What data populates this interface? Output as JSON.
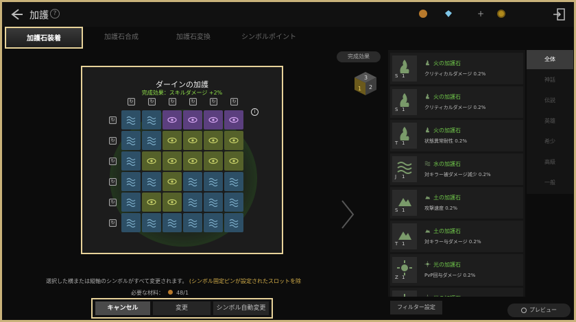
{
  "header": {
    "title": "加護",
    "help": "?"
  },
  "tabs": [
    {
      "label": "加護石装着",
      "active": true
    },
    {
      "label": "加護石合成",
      "active": false
    },
    {
      "label": "加護石変換",
      "active": false
    },
    {
      "label": "シンボルポイント",
      "active": false
    }
  ],
  "board": {
    "title": "ダーインの加護",
    "effect": "完成効果：スキルダメージ +2%",
    "info": "i"
  },
  "complete_button": "完成効果",
  "cube": {
    "faces": [
      "3",
      "1",
      "2"
    ]
  },
  "instructions": {
    "main": "選択した横または縦軸のシンボルがすべて変更されます。",
    "highlight": "(シンボル固定ピンが設定されたスロットを除"
  },
  "materials": {
    "label": "必要な材料：",
    "value": "48/1"
  },
  "buttons": {
    "cancel": "キャンセル",
    "change": "変更",
    "auto": "シンボル自動変更"
  },
  "right_tabs": [
    "全体",
    "神話",
    "伝説",
    "英雄",
    "希少",
    "高級",
    "一般"
  ],
  "items": [
    {
      "name": "火の加護石",
      "stat": "クリティカルダメージ 0.2%",
      "letter": "S",
      "count": "1",
      "color": "#6fc54a",
      "icon": "fire-icon"
    },
    {
      "name": "火の加護石",
      "stat": "クリティカルダメージ 0.2%",
      "letter": "S",
      "count": "1",
      "color": "#6fc54a",
      "icon": "fire-icon"
    },
    {
      "name": "火の加護石",
      "stat": "状態異常耐性 0.2%",
      "letter": "T",
      "count": "1",
      "color": "#6fc54a",
      "icon": "fire-icon"
    },
    {
      "name": "水の加護石",
      "stat": "対キラー被ダメージ減少 0.2%",
      "letter": "J",
      "count": "1",
      "color": "#6fc54a",
      "icon": "water-icon"
    },
    {
      "name": "土の加護石",
      "stat": "攻撃速度 0.2%",
      "letter": "S",
      "count": "1",
      "color": "#6fc54a",
      "icon": "earth-icon"
    },
    {
      "name": "土の加護石",
      "stat": "対キラー与ダメージ 0.2%",
      "letter": "T",
      "count": "1",
      "color": "#6fc54a",
      "icon": "earth-icon"
    },
    {
      "name": "光の加護石",
      "stat": "PvP回与ダメージ 0.2%",
      "letter": "Z",
      "count": "1",
      "color": "#6fc54a",
      "icon": "light-icon"
    },
    {
      "name": "光の加護石",
      "stat": "",
      "letter": "",
      "count": "",
      "color": "#6fc54a",
      "icon": "light-icon"
    }
  ],
  "filter_button": "フィルター設定",
  "preview_button": "プレビュー",
  "colors": {
    "accent": "#e8d39a",
    "green": "#6fc54a",
    "orange": "#d6b04a"
  }
}
